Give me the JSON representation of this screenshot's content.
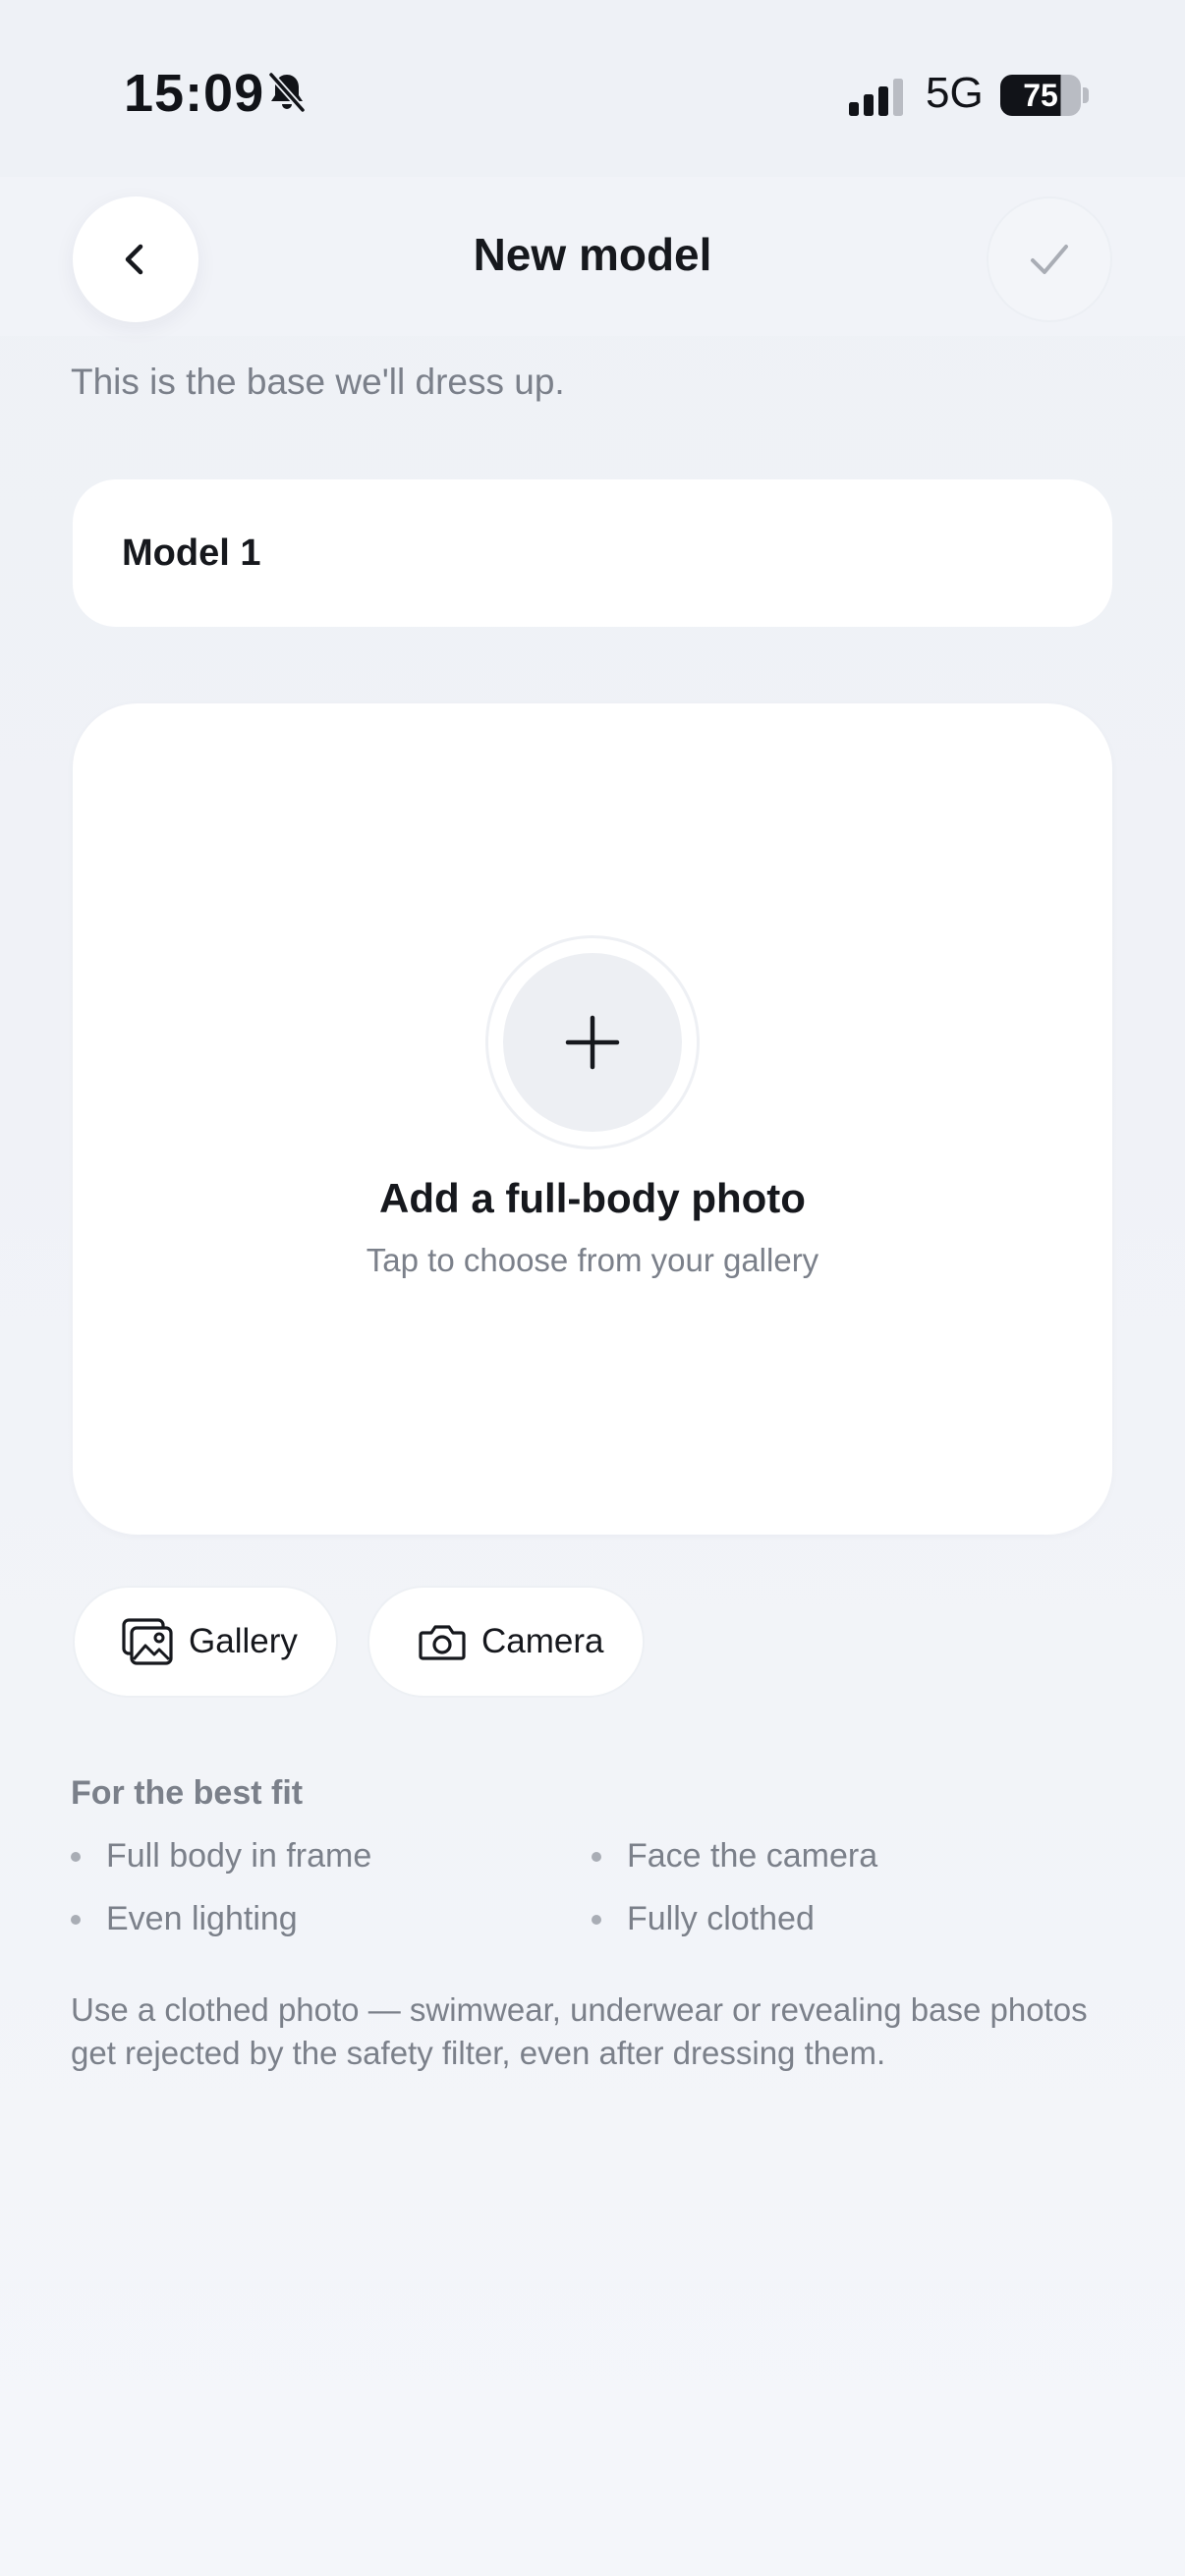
{
  "status_bar": {
    "time": "15:09",
    "network": "5G",
    "battery": "75",
    "icons": [
      "bell-slash-icon",
      "cellular-signal-icon",
      "battery-icon"
    ]
  },
  "header": {
    "title": "New model",
    "back_icon": "chevron-left-icon",
    "confirm_icon": "checkmark-icon"
  },
  "subtitle": "This is the base we'll dress up.",
  "name_field": {
    "value": "Model 1"
  },
  "photo_picker": {
    "icon": "plus-icon",
    "title": "Add a full-body photo",
    "hint": "Tap to choose from your gallery"
  },
  "sources": {
    "gallery": {
      "label": "Gallery",
      "icon": "photo-gallery-icon"
    },
    "camera": {
      "label": "Camera",
      "icon": "camera-icon"
    }
  },
  "tips": {
    "heading": "For the best fit",
    "items": [
      "Full body in frame",
      "Face the camera",
      "Even lighting",
      "Fully clothed"
    ]
  },
  "warning": "Use a clothed photo — swimwear, underwear or revealing base photos get rejected by the safety filter, even after dressing them.",
  "colors": {
    "background": "#f0f2f7",
    "card": "#ffffff",
    "text_primary": "#16181d",
    "text_secondary": "#7b808a",
    "disabled_check": "#a9adb5"
  }
}
